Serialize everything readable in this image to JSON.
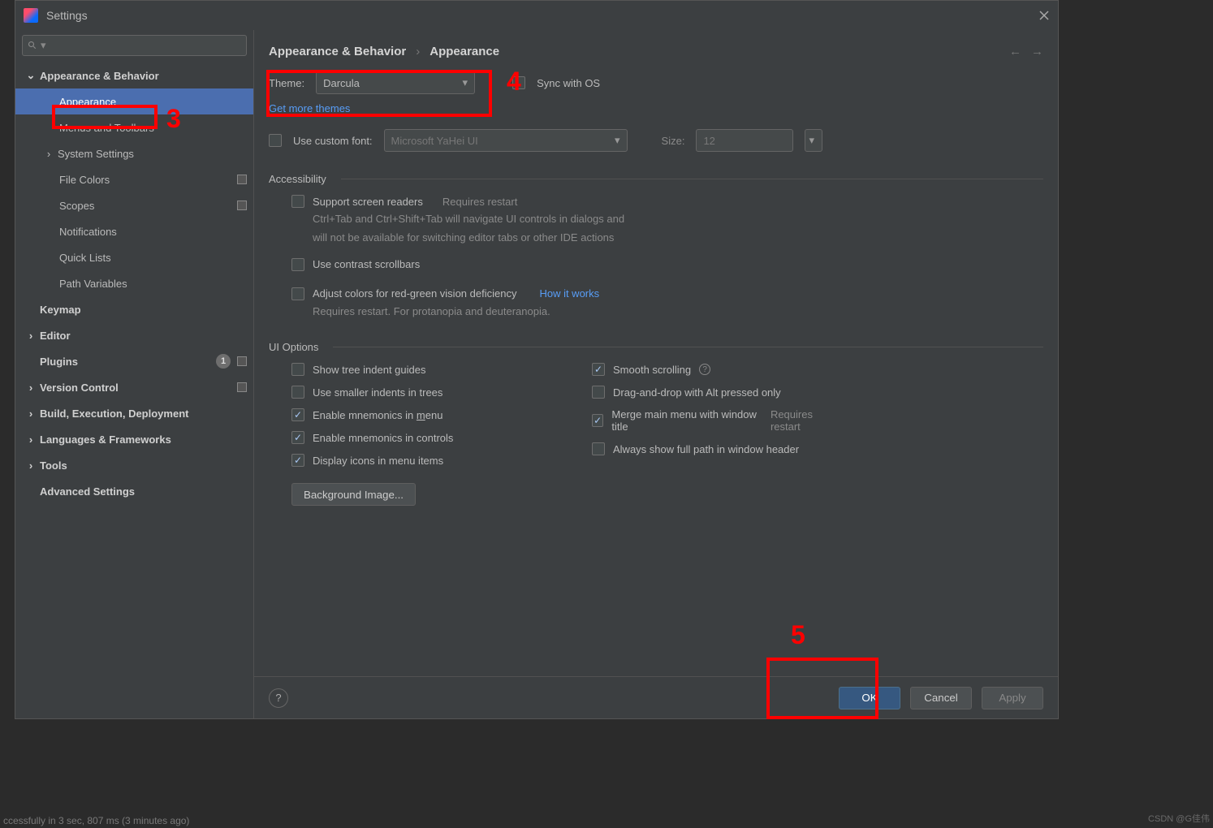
{
  "dialog": {
    "title": "Settings"
  },
  "search": {
    "placeholder": ""
  },
  "tree": {
    "appearance_behavior": "Appearance & Behavior",
    "appearance": "Appearance",
    "menus_toolbars": "Menus and Toolbars",
    "system_settings": "System Settings",
    "file_colors": "File Colors",
    "scopes": "Scopes",
    "notifications": "Notifications",
    "quick_lists": "Quick Lists",
    "path_variables": "Path Variables",
    "keymap": "Keymap",
    "editor": "Editor",
    "plugins": "Plugins",
    "plugins_badge": "1",
    "version_control": "Version Control",
    "build": "Build, Execution, Deployment",
    "languages": "Languages & Frameworks",
    "tools": "Tools",
    "advanced": "Advanced Settings"
  },
  "breadcrumb": {
    "parent": "Appearance & Behavior",
    "sep": "›",
    "current": "Appearance"
  },
  "theme": {
    "label": "Theme:",
    "value": "Darcula",
    "sync_label": "Sync with OS",
    "get_more": "Get more themes"
  },
  "font": {
    "use_custom_label": "Use custom font:",
    "font_value": "Microsoft YaHei UI",
    "size_label": "Size:",
    "size_value": "12"
  },
  "accessibility": {
    "title": "Accessibility",
    "screen_readers": "Support screen readers",
    "requires_restart": "Requires restart",
    "sr_hint1": "Ctrl+Tab and Ctrl+Shift+Tab will navigate UI controls in dialogs and",
    "sr_hint2": "will not be available for switching editor tabs or other IDE actions",
    "contrast": "Use contrast scrollbars",
    "colorblind": "Adjust colors for red-green vision deficiency",
    "how_it_works": "How it works",
    "cb_hint": "Requires restart. For protanopia and deuteranopia."
  },
  "ui": {
    "title": "UI Options",
    "tree_guides": "Show tree indent guides",
    "smaller_indents": "Use smaller indents in trees",
    "mnemonics_menu_pre": "Enable mnemonics in ",
    "mnemonics_menu_u": "m",
    "mnemonics_menu_post": "enu",
    "mnemonics_controls": "Enable mnemonics in controls",
    "icons_menu": "Display icons in menu items",
    "smooth": "Smooth scrolling",
    "dnd_alt": "Drag-and-drop with Alt pressed only",
    "merge_menu": "Merge main menu with window title",
    "full_path": "Always show full path in window header",
    "bg_image": "Background Image..."
  },
  "footer": {
    "ok": "OK",
    "cancel": "Cancel",
    "apply": "Apply"
  },
  "annotations": {
    "n3": "3",
    "n4": "4",
    "n5": "5"
  },
  "watermark": "CSDN @G佳伟",
  "statusline": "ccessfully in 3 sec, 807 ms (3 minutes ago)"
}
